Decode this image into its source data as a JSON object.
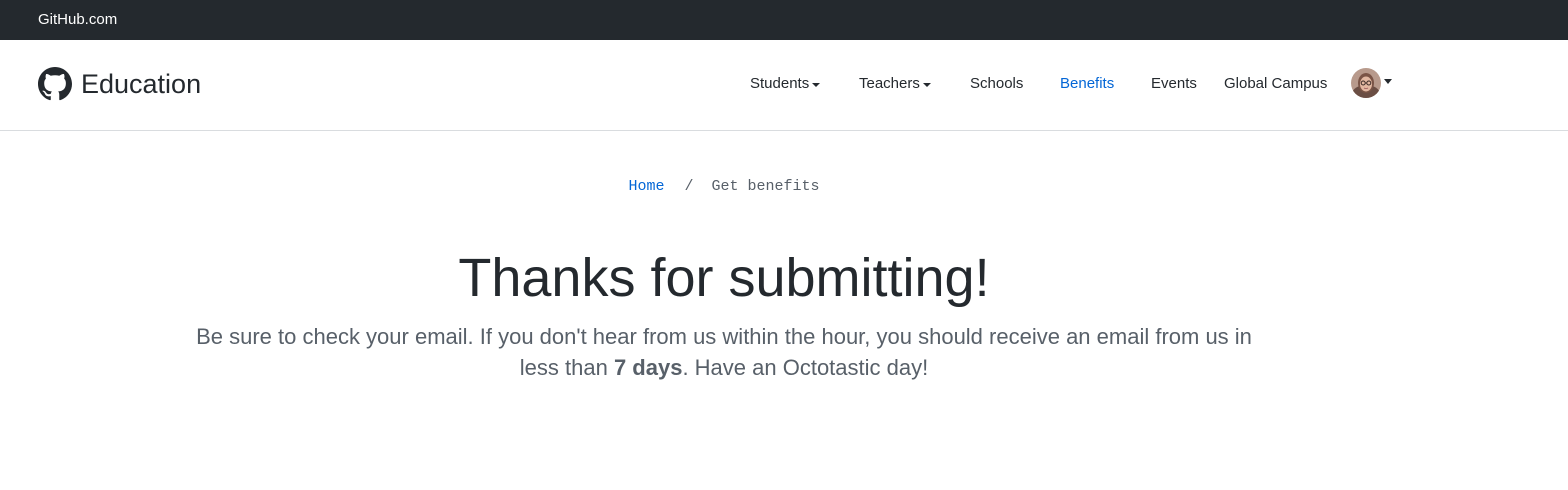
{
  "topbar": {
    "link_label": "GitHub.com"
  },
  "header": {
    "brand_label": "Education",
    "nav": {
      "students": "Students",
      "teachers": "Teachers",
      "schools": "Schools",
      "benefits": "Benefits",
      "events": "Events",
      "global_campus": "Global Campus"
    },
    "active_item": "Benefits",
    "accent_color": "#0366d6"
  },
  "breadcrumb": {
    "home": "Home",
    "separator": "/",
    "current": "Get benefits"
  },
  "main": {
    "title": "Thanks for submitting!",
    "lead_before": "Be sure to check your email. If you don't hear from us within the hour, you should receive an email from us in less than ",
    "lead_bold": "7 days",
    "lead_after": ". Have an Octotastic day!"
  },
  "icons": {
    "logo": "github-octocat-icon",
    "user": "avatar"
  }
}
